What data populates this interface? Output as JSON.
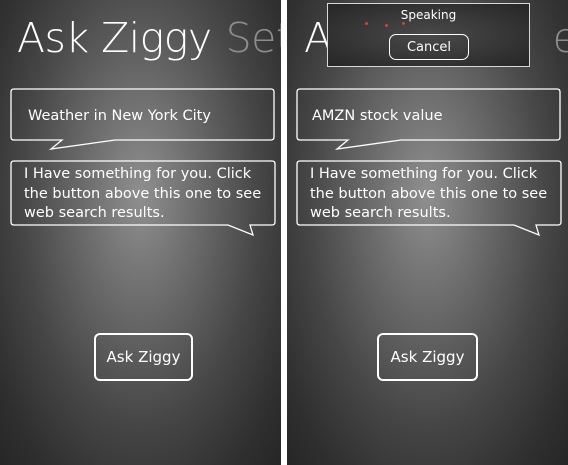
{
  "screens": [
    {
      "pivot": {
        "active": "Ask Ziggy",
        "inactive": "Setti"
      },
      "query_bubble": "Weather in New York City",
      "response_bubble": "I Have something for you. Click the button above this one to see web search results.",
      "ask_button": "Ask Ziggy"
    },
    {
      "pivot": {
        "active": "A",
        "inactive": "etti"
      },
      "query_bubble": "AMZN stock value",
      "response_bubble": "I Have something for you. Click the button above this one to see web search results.",
      "ask_button": "Ask Ziggy",
      "speaking_overlay": {
        "title": "Speaking",
        "cancel_label": "Cancel"
      }
    }
  ],
  "colors": {
    "text": "#ffffff",
    "pivot_inactive": "#8d8d8d",
    "speaking_dots": "#d04040"
  }
}
